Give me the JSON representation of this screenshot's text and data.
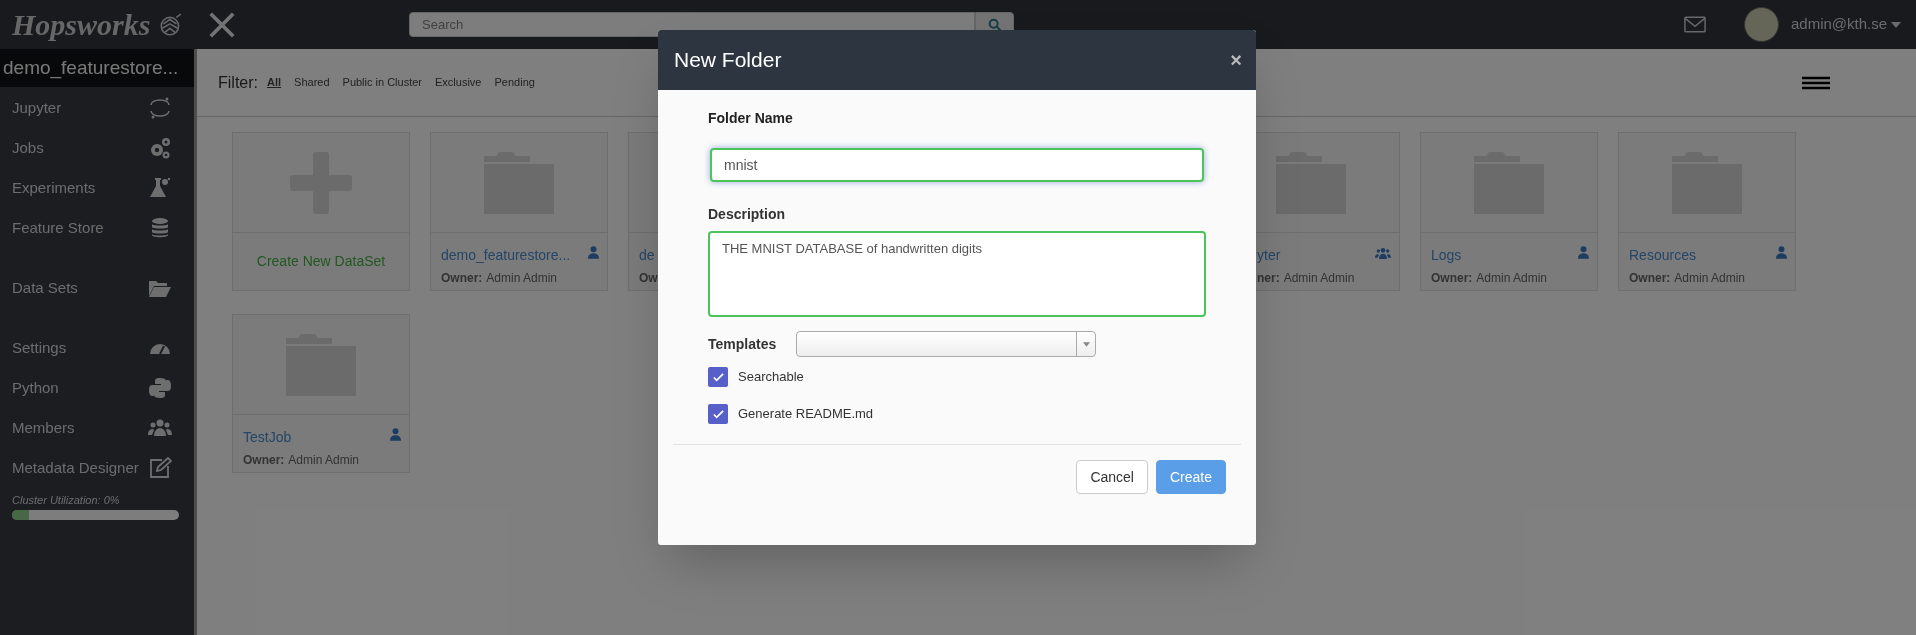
{
  "topbar": {
    "logo": "Hopsworks",
    "search": {
      "placeholder": "Search"
    },
    "user": "admin@kth.se"
  },
  "sidebar": {
    "project": "demo_featurestore...",
    "groups": [
      [
        {
          "label": "Jupyter"
        },
        {
          "label": "Jobs"
        },
        {
          "label": "Experiments"
        },
        {
          "label": "Feature Store"
        }
      ],
      [
        {
          "label": "Data Sets"
        }
      ],
      [
        {
          "label": "Settings"
        },
        {
          "label": "Python"
        },
        {
          "label": "Members"
        },
        {
          "label": "Metadata Designer"
        }
      ]
    ],
    "cluster": {
      "label": "Cluster Utilization: 0%",
      "level": 0.1
    }
  },
  "filter": {
    "label": "Filter:",
    "options": [
      {
        "label": "All",
        "selected": true
      },
      {
        "label": "Shared",
        "selected": false
      },
      {
        "label": "Public in Cluster",
        "selected": false
      },
      {
        "label": "Exclusive",
        "selected": false
      },
      {
        "label": "Pending",
        "selected": false
      }
    ]
  },
  "cards": [
    {
      "kind": "create",
      "label": "Create New DataSet"
    },
    {
      "kind": "folder",
      "name": "demo_featurestore...",
      "owner_label": "Owner:",
      "owner": "Admin Admin",
      "shared": false
    },
    {
      "kind": "cut_right",
      "name": "de",
      "owner_label": "Ow"
    },
    {
      "kind": "cut_left",
      "name": "yter",
      "owner_label": "ner:",
      "owner": "Admin Admin",
      "shared": true
    },
    {
      "kind": "folder",
      "name": "Logs",
      "owner_label": "Owner:",
      "owner": "Admin Admin",
      "shared": false
    },
    {
      "kind": "folder",
      "name": "Resources",
      "owner_label": "Owner:",
      "owner": "Admin Admin",
      "shared": false
    },
    {
      "kind": "folder",
      "name": "TestJob",
      "owner_label": "Owner:",
      "owner": "Admin Admin",
      "shared": false
    }
  ],
  "dialog": {
    "title": "New Folder",
    "close": "×",
    "folder_name": {
      "label": "Folder Name",
      "value": "mnist"
    },
    "description": {
      "label": "Description",
      "value": "THE MNIST DATABASE of handwritten digits"
    },
    "templates": {
      "label": "Templates"
    },
    "options": [
      {
        "label": "Searchable",
        "checked": true
      },
      {
        "label": "Generate README.md",
        "checked": true
      }
    ],
    "buttons": [
      {
        "kind": "secondary",
        "label": "Cancel"
      },
      {
        "kind": "primary",
        "label": "Create"
      }
    ]
  }
}
